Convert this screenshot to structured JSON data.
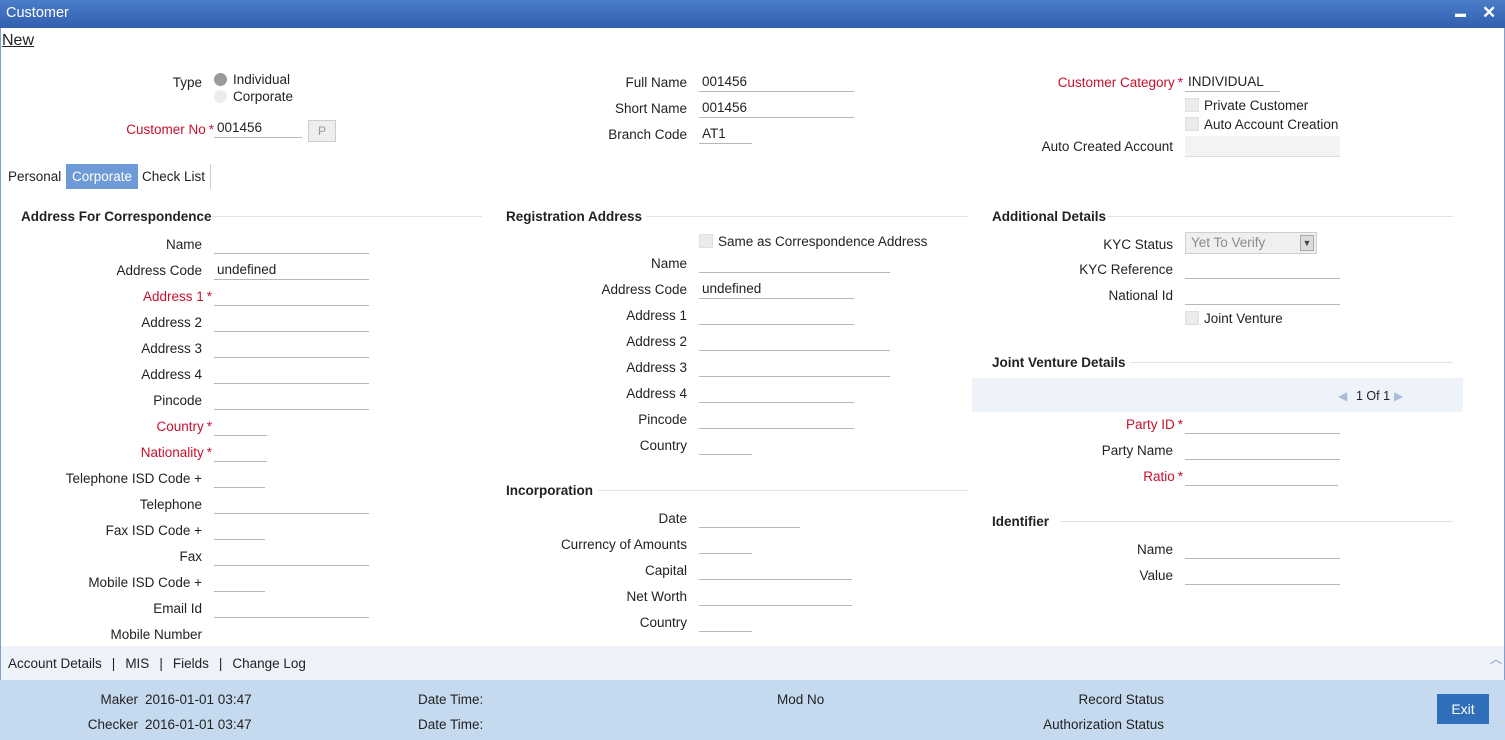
{
  "window": {
    "title": "Customer",
    "minimize": "▬",
    "close": "✕"
  },
  "menu": {
    "new": "New"
  },
  "header": {
    "type_label": "Type",
    "type_options": [
      "Individual",
      "Corporate"
    ],
    "customer_no_label": "Customer No",
    "customer_no_value": "001456",
    "p_button": "P",
    "full_name_label": "Full Name",
    "full_name_value": "001456",
    "short_name_label": "Short Name",
    "short_name_value": "001456",
    "branch_code_label": "Branch Code",
    "branch_code_value": "AT1",
    "customer_category_label": "Customer Category",
    "customer_category_value": "INDIVIDUAL",
    "private_customer_label": "Private Customer",
    "auto_account_creation_label": "Auto Account Creation",
    "auto_created_account_label": "Auto Created Account"
  },
  "tabs": [
    "Personal",
    "Corporate",
    "Check List"
  ],
  "correspondence": {
    "title": "Address For Correspondence",
    "name": "Name",
    "address_code": "Address Code",
    "address_code_value": "undefined",
    "address1": "Address 1",
    "address2": "Address 2",
    "address3": "Address 3",
    "address4": "Address 4",
    "pincode": "Pincode",
    "country": "Country",
    "nationality": "Nationality",
    "tel_isd": "Telephone ISD Code +",
    "telephone": "Telephone",
    "fax_isd": "Fax ISD Code +",
    "fax": "Fax",
    "mobile_isd": "Mobile ISD Code +",
    "email": "Email Id",
    "mobile": "Mobile Number"
  },
  "registration": {
    "title": "Registration Address",
    "same_as": "Same as Correspondence Address",
    "name": "Name",
    "address_code": "Address Code",
    "address_code_value": "undefined",
    "address1": "Address 1",
    "address2": "Address 2",
    "address3": "Address 3",
    "address4": "Address 4",
    "pincode": "Pincode",
    "country": "Country"
  },
  "incorporation": {
    "title": "Incorporation",
    "date": "Date",
    "currency": "Currency of Amounts",
    "capital": "Capital",
    "net_worth": "Net Worth",
    "country": "Country"
  },
  "additional": {
    "title": "Additional Details",
    "kyc_status": "KYC Status",
    "kyc_status_value": "Yet To Verify",
    "kyc_reference": "KYC Reference",
    "national_id": "National Id",
    "joint_venture": "Joint Venture"
  },
  "jv": {
    "title": "Joint Venture Details",
    "pager": "1 Of 1",
    "party_id": "Party ID",
    "party_name": "Party Name",
    "ratio": "Ratio"
  },
  "identifier": {
    "title": "Identifier",
    "name": "Name",
    "value": "Value"
  },
  "bottom_links": [
    "Account Details",
    "MIS",
    "Fields",
    "Change Log"
  ],
  "footer": {
    "maker_label": "Maker",
    "maker_value": "2016-01-01 03:47",
    "checker_label": "Checker",
    "checker_value": "2016-01-01 03:47",
    "date_time": "Date Time:",
    "mod_no": "Mod No",
    "record_status": "Record Status",
    "authorization_status": "Authorization Status",
    "exit": "Exit"
  },
  "colors": {
    "title_bar": "#2f5fae",
    "required": "#c8102e",
    "tab_active": "#6e9ad7",
    "footer": "#c6daef",
    "exit": "#2f6fba"
  }
}
